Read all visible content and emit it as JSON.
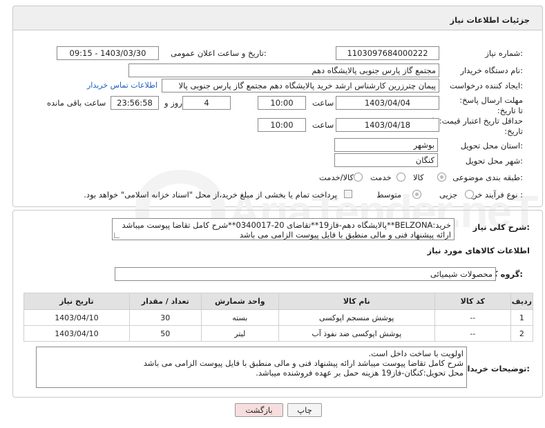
{
  "header": {
    "title": "جزئیات اطلاعات نیاز"
  },
  "form": {
    "need_number": {
      "label": "شماره نیاز:",
      "value": "1103097684000222"
    },
    "announce": {
      "label": "تاریخ و ساعت اعلان عمومی:",
      "value": "1403/03/30 - 09:15"
    },
    "buyer_org": {
      "label": "نام دستگاه خریدار:",
      "value": "مجتمع گاز پارس جنوبی  پالایشگاه دهم"
    },
    "creator": {
      "label": "ایجاد کننده درخواست:",
      "value": "پیمان چترزرین کارشناس ارشد خرید پالایشگاه دهم مجتمع گاز پارس جنوبی  پالا",
      "link": "اطلاعات تماس خریدار"
    },
    "reply_deadline": {
      "label": "مهلت ارسال پاسخ: تا تاریخ:",
      "date": "1403/04/04",
      "time_label": "ساعت",
      "time": "10:00",
      "days": "4",
      "days_label": "روز و",
      "remaining": "23:56:58",
      "remaining_label": "ساعت باقی مانده"
    },
    "price_validity": {
      "label": "حداقل تاریخ اعتبار قیمت: تا تاریخ:",
      "date": "1403/04/18",
      "time_label": "ساعت",
      "time": "10:00"
    },
    "province": {
      "label": "استان محل تحویل:",
      "value": "بوشهر"
    },
    "city": {
      "label": "شهر محل تحویل:",
      "value": "کنگان"
    },
    "category": {
      "label": "طبقه بندی موضوعی:",
      "options": [
        "کالا",
        "خدمت",
        "کالا/خدمت"
      ]
    },
    "process": {
      "label": "نوع فرآیند خرید :",
      "options": [
        "جزیی",
        "متوسط"
      ],
      "note": "پرداخت تمام یا بخشی از مبلغ خرید،از محل \"اسناد خزانه اسلامی\" خواهد بود."
    }
  },
  "summary": {
    "label": "شرح کلی نیاز:",
    "text": "خرید:BELZONA**پالایشگاه دهم-فاز19**تقاضای 20-0340017**شرح کامل تقاضا پیوست میباشد ارائه پیشنهاد فنی و مالی منطبق با فایل پیوست الزامی می باشد"
  },
  "goods": {
    "section_title": "اطلاعات کالاهای مورد نیاز",
    "group_label": "گروه کالا:",
    "group_value": "محصولات شیمیائی",
    "columns": [
      "ردیف",
      "کد کالا",
      "نام کالا",
      "واحد شمارش",
      "تعداد / مقدار",
      "تاریخ نیاز"
    ],
    "rows": [
      [
        "1",
        "--",
        "پوشش منسجم اپوکسی",
        "بسته",
        "30",
        "1403/04/10"
      ],
      [
        "2",
        "--",
        "پوشش اپوکسی ضد نفوذ آب",
        "لیتر",
        "50",
        "1403/04/10"
      ]
    ]
  },
  "buyer_notes": {
    "label": "توضیحات خریدار:",
    "lines": [
      "اولویت با ساخت داخل است.",
      "شرح کامل تقاضا پیوست میباشد ارائه پیشنهاد فنی و مالی منطبق با فایل پیوست الزامی می باشد",
      "محل تحویل:کنگان-فاز19 هزینه حمل بر عهده فروشنده میباشد."
    ]
  },
  "buttons": {
    "print": "چاپ",
    "back": "بازگشت"
  },
  "colors": {
    "link": "#1b5fbf",
    "back_button_bg": "#f7dede",
    "header_bg": "#efefef"
  }
}
